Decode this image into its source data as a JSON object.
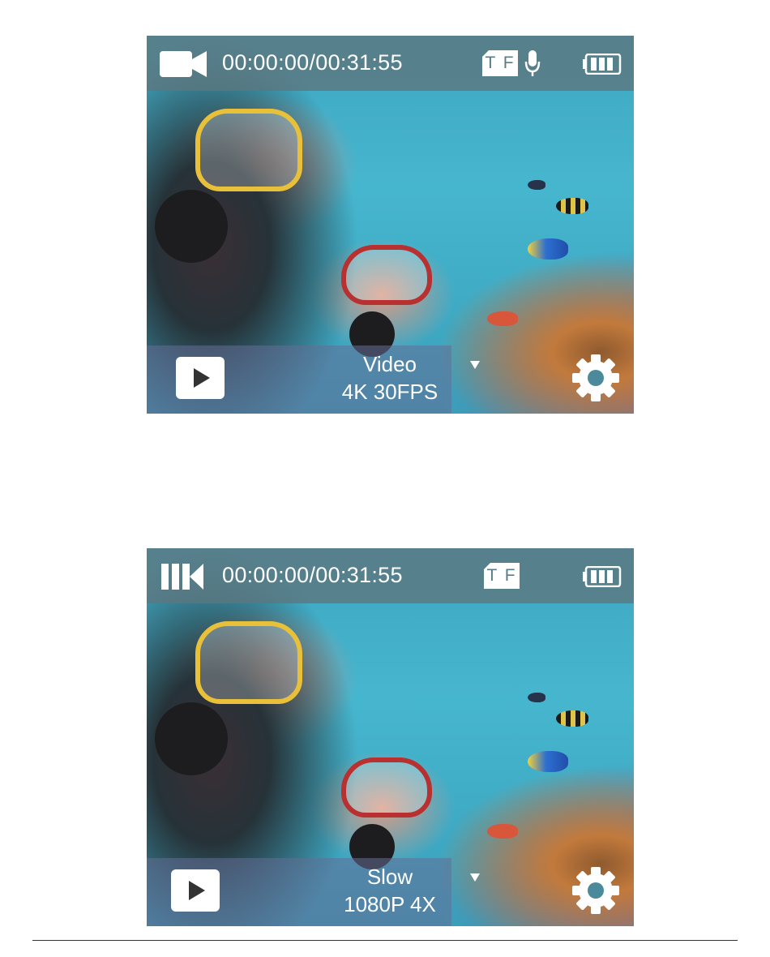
{
  "screens": [
    {
      "mode_icon": "video-camera-icon",
      "time": "00:00:00/00:31:55",
      "storage": "T F",
      "show_mic": true,
      "mode_name": "Video",
      "mode_detail": "4K 30FPS"
    },
    {
      "mode_icon": "slow-motion-icon",
      "time": "00:00:00/00:31:55",
      "storage": "T F",
      "show_mic": false,
      "mode_name": "Slow",
      "mode_detail": "1080P 4X"
    }
  ],
  "colors": {
    "overlay": "#5c7880",
    "icon": "#ffffff",
    "tf_text": "#5a7c86"
  }
}
